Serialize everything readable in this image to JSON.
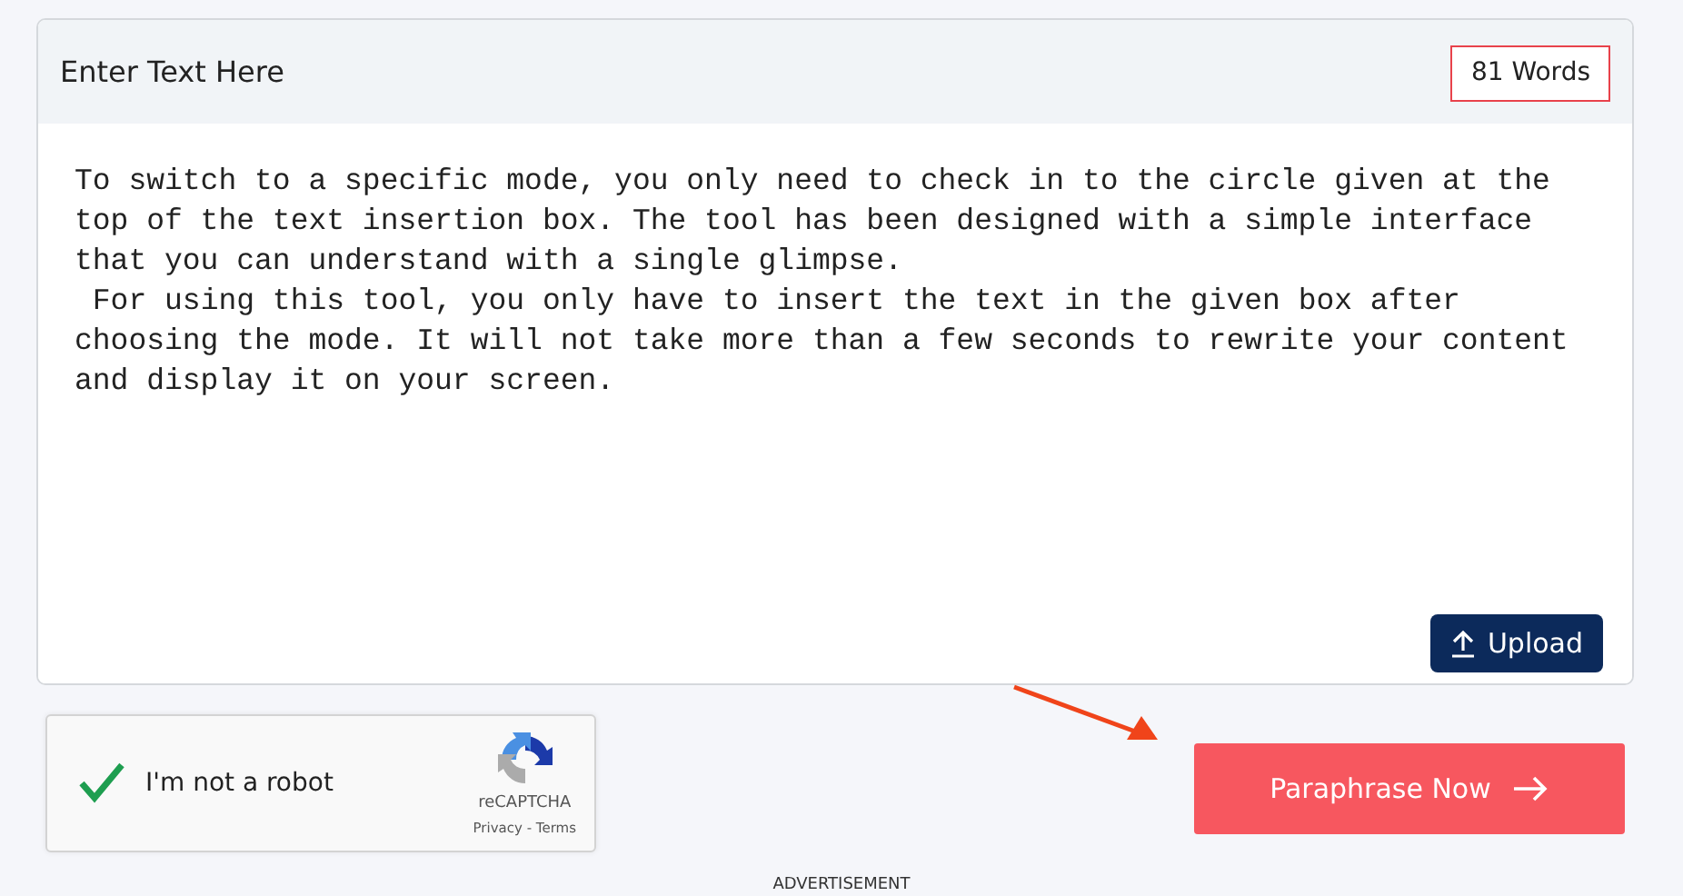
{
  "editor": {
    "title": "Enter Text Here",
    "word_count": "81 Words",
    "text": "To switch to a specific mode, you only need to check in to the circle given at the top of the text insertion box. The tool has been designed with a simple interface that you can understand with a single glimpse.\n For using this tool, you only have to insert the text in the given box after choosing the mode. It will not take more than a few seconds to rewrite your content and display it on your screen.",
    "upload_button": "Upload"
  },
  "captcha": {
    "label": "I'm not a robot",
    "checked": true,
    "brand": "reCAPTCHA",
    "links": "Privacy - Terms"
  },
  "submit_button": "Paraphrase Now",
  "ad_label": "ADVERTISEMENT"
}
